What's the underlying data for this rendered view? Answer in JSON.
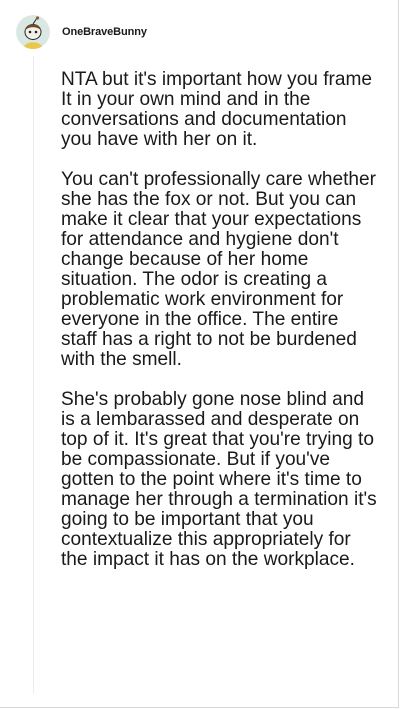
{
  "comment": {
    "username": "OneBraveBunny",
    "avatar_icon": "snoo-avatar-icon",
    "paragraphs": [
      "NTA but it's important how you frame It in your own mind and in the conversations and documentation you have with her on it.",
      "You can't professionally care whether she has the fox or not. But you can make it clear that your expectations for attendance and hygiene don't change because of her home situation. The odor is creating a problematic work environment for everyone in the office. The entire staff has a right to not be burdened with the smell.",
      "She's probably gone nose blind and is a lembarassed and desperate on top of it. It's great that you're trying to be compassionate. But if you've gotten to the point where it's time to manage her through a termination it's going to be important that you contextualize this appropriately for the impact it has on the workplace."
    ]
  },
  "colors": {
    "text": "#1a1a1b",
    "avatar_bg": "#d9e8e2",
    "avatar_body": "#e8c84a",
    "thread_line": "#ececec"
  }
}
